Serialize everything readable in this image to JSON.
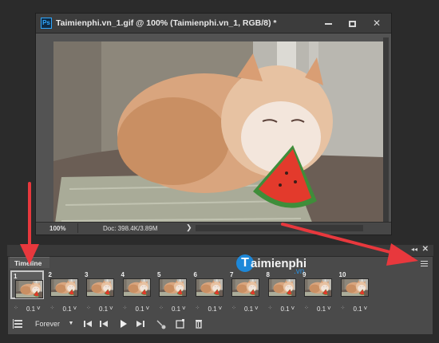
{
  "window": {
    "app_icon": "Ps",
    "title": "Taimienphi.vn_1.gif @ 100% (Taimienphi.vn_1, RGB/8) *",
    "minimize": "minimize-icon",
    "maximize": "maximize-icon",
    "close": "✕"
  },
  "status": {
    "zoom": "100%",
    "doc_info": "Doc: 398.4K/3.89M",
    "menu_caret": "❯"
  },
  "panel": {
    "collapse": "◂◂",
    "close": "✕",
    "tab_label": "Timeline",
    "menu_icon": "hamburger-icon"
  },
  "brand": {
    "initial": "T",
    "name": "aimienphi",
    "tld": ".vn"
  },
  "frames": [
    {
      "num": "1",
      "delay": "0.1",
      "selected": true
    },
    {
      "num": "2",
      "delay": "0.1",
      "selected": false
    },
    {
      "num": "3",
      "delay": "0.1",
      "selected": false
    },
    {
      "num": "4",
      "delay": "0.1",
      "selected": false
    },
    {
      "num": "5",
      "delay": "0.1",
      "selected": false
    },
    {
      "num": "6",
      "delay": "0.1",
      "selected": false
    },
    {
      "num": "7",
      "delay": "0.1",
      "selected": false
    },
    {
      "num": "8",
      "delay": "0.1",
      "selected": false
    },
    {
      "num": "9",
      "delay": "0.1",
      "selected": false
    },
    {
      "num": "10",
      "delay": "0.1",
      "selected": false
    }
  ],
  "controls": {
    "convert": "convert-frames-icon",
    "loop": "Forever",
    "loop_caret": "▼",
    "first": "first-frame-icon",
    "prev": "previous-frame-icon",
    "play": "play-icon",
    "next": "next-frame-icon",
    "tween": "tween-icon",
    "duplicate": "duplicate-frame-icon",
    "delete": "delete-frame-icon"
  },
  "colors": {
    "annotation_arrow": "#e8383d",
    "brand_blue": "#1d88d9"
  }
}
